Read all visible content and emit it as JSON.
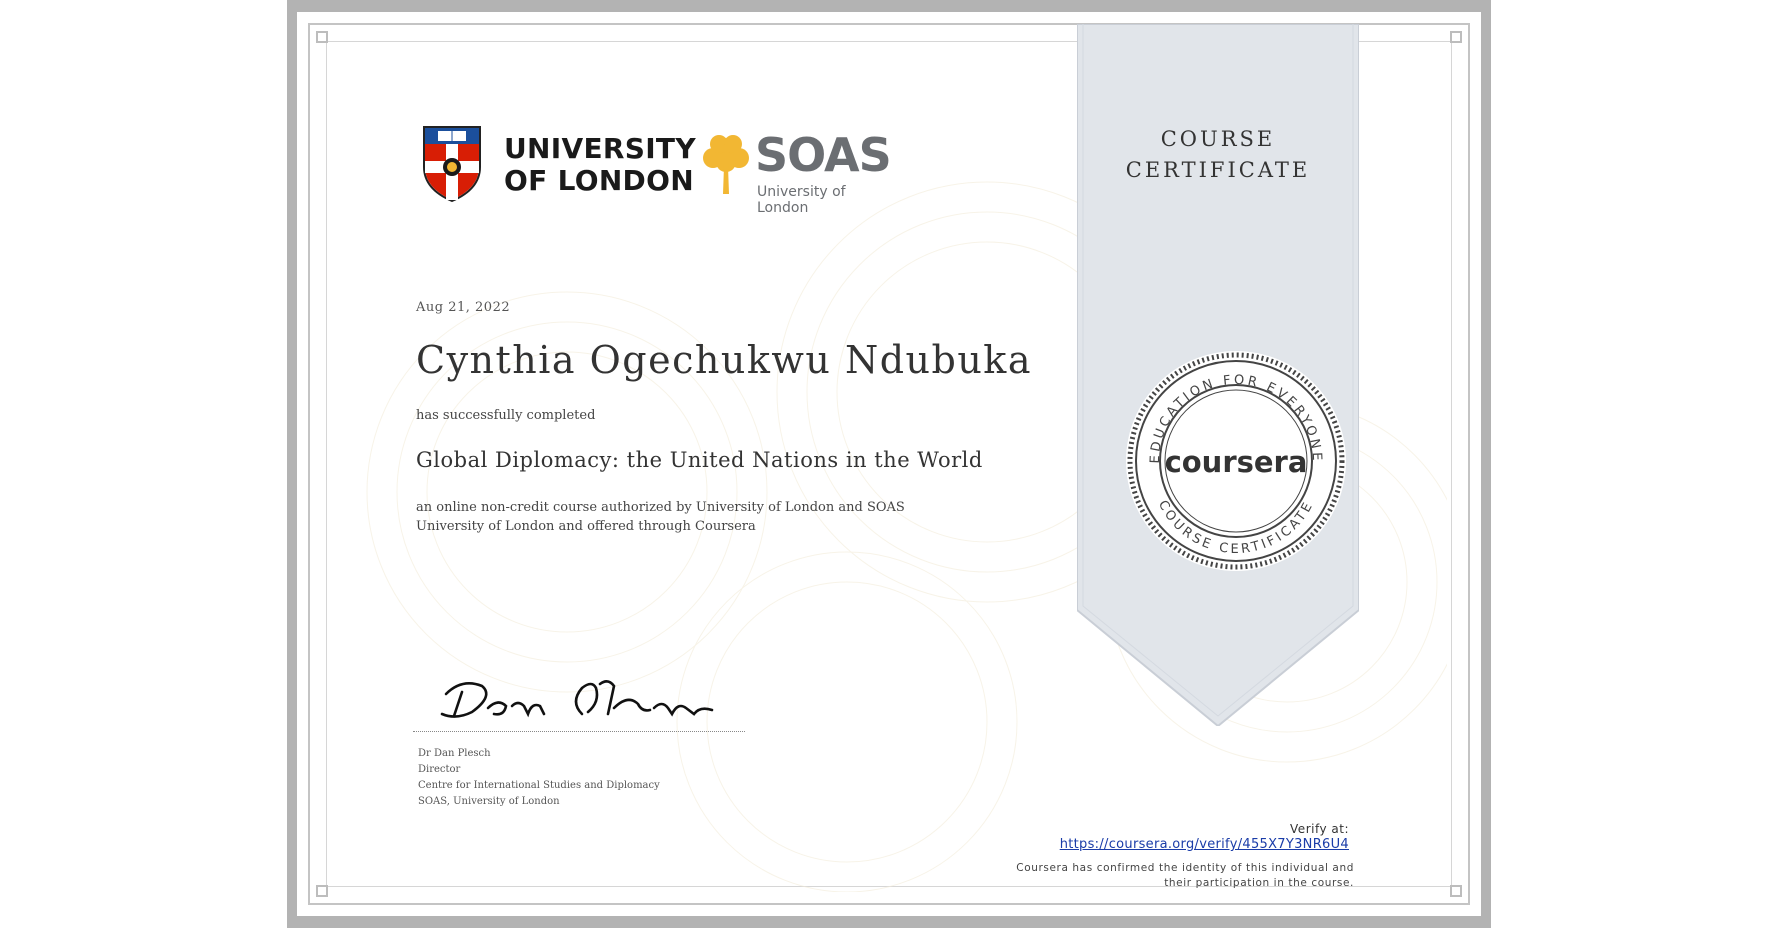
{
  "logos": {
    "uol_line1": "UNIVERSITY",
    "uol_line2": "OF LONDON",
    "soas_word": "SOAS",
    "soas_sub": "University of London"
  },
  "certificate": {
    "ribbon_line1": "COURSE",
    "ribbon_line2": "CERTIFICATE",
    "date": "Aug 21, 2022",
    "recipient": "Cynthia Ogechukwu Ndubuka",
    "completed_text": "has successfully completed",
    "course_title": "Global Diplomacy: the United Nations in the World",
    "description": "an online non-credit course authorized by University of London and SOAS University of London and offered through Coursera"
  },
  "signatory": {
    "name": "Dr Dan Plesch",
    "role": "Director",
    "department": "Centre for International Studies and Diplomacy",
    "institution": "SOAS, University of London"
  },
  "seal": {
    "brand": "coursera",
    "top_arc": "EDUCATION FOR EVERYONE",
    "bottom_arc": "COURSE CERTIFICATE"
  },
  "verification": {
    "label": "Verify at:",
    "url": "https://coursera.org/verify/455X7Y3NR6U4",
    "confirmed_line1": "Coursera has confirmed the identity of this individual and",
    "confirmed_line2": "their participation in the course."
  },
  "colors": {
    "ribbon": "#e1e5ea",
    "link": "#1a3ca8",
    "outer_frame": "#b3b3b3",
    "soas_tree": "#f2b733",
    "uol_red": "#d81e05",
    "uol_blue": "#1b4f9c"
  }
}
